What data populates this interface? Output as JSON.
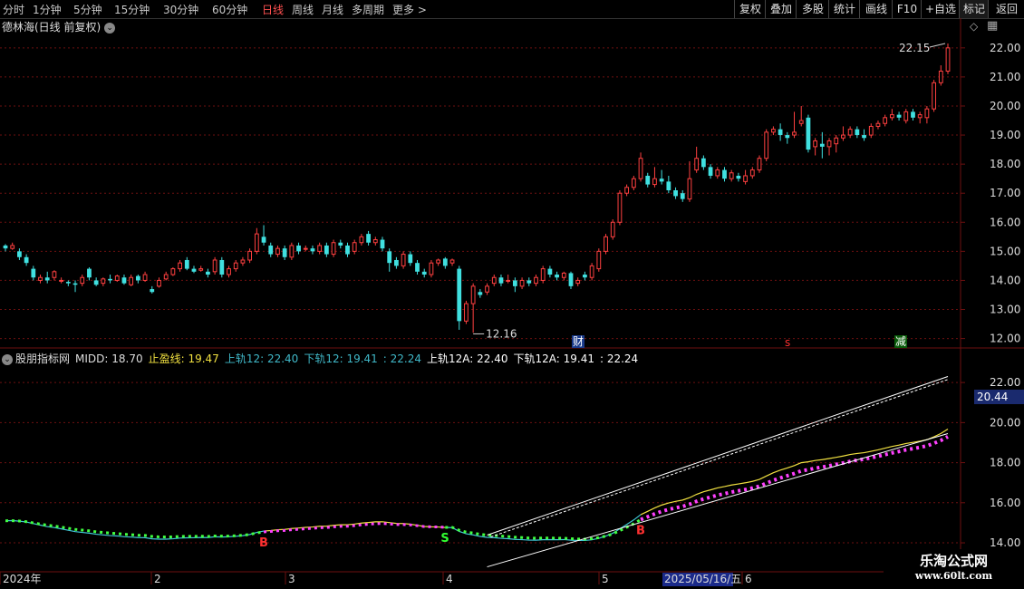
{
  "toolbar": {
    "items": [
      "分时",
      "1分钟",
      "5分钟",
      "15分钟",
      "30分钟",
      "60分钟",
      "日线",
      "周线",
      "月线",
      "多周期",
      "更多 >"
    ],
    "active_index": 6,
    "right_items": [
      "复权",
      "叠加",
      "多股",
      "统计",
      "画线",
      "F10",
      "+自选",
      "返回"
    ]
  },
  "title": {
    "text": "德林海(日线 前复权)",
    "chevron": "⌄",
    "dia_icon": "◇",
    "grid_icon": "▦"
  },
  "price_axis": {
    "labels": [
      "22.00",
      "21.00",
      "20.00",
      "19.00",
      "18.00",
      "17.00",
      "16.00",
      "15.00",
      "14.00",
      "13.00",
      "12.00"
    ]
  },
  "annotations": {
    "high": "22.15",
    "low": "12.16",
    "cai": "财",
    "s_mark": "s",
    "jian": "减"
  },
  "indicator": {
    "chevron": "⌄",
    "name": "股朋指标网",
    "midd": "MIDD: 18.70",
    "stop": "止盈线: 19.47",
    "upper12": "上轨12: 22.40",
    "lower12": "下轨12: 19.41",
    "val1": ": 22.24",
    "upper12a": "上轨12A: 22.40",
    "lower12a": "下轨12A: 19.41",
    "val2": ": 22.24",
    "axis": [
      "22.00",
      "20.00",
      "18.00",
      "16.00",
      "14.00"
    ],
    "last_value": "20.44",
    "marks": {
      "b1": "B",
      "s1": "S",
      "b2": "B"
    }
  },
  "date_axis": {
    "labels": [
      "2024年",
      "2",
      "3",
      "4",
      "5",
      "6"
    ],
    "highlight": "2025/05/16/五"
  },
  "watermark": {
    "line1": "乐淘公式网",
    "line2": "www.60lt.com"
  },
  "colors": {
    "up": "#ff4040",
    "down": "#40e0e0",
    "bg": "#000000",
    "grid": "#6e1010",
    "yellow": "#f0e040",
    "magenta": "#ff40ff",
    "green": "#40ff40",
    "cyan": "#40c8d8"
  },
  "chart_data": {
    "type": "candlestick",
    "price_range": [
      11.8,
      22.4
    ],
    "candles": [
      [
        15.2,
        15.1,
        15.25,
        15.0
      ],
      [
        15.1,
        15.2,
        15.3,
        15.05
      ],
      [
        15.0,
        14.8,
        15.1,
        14.7
      ],
      [
        14.8,
        14.6,
        14.9,
        14.5
      ],
      [
        14.4,
        14.1,
        14.5,
        14.0
      ],
      [
        14.0,
        14.1,
        14.2,
        13.9
      ],
      [
        14.1,
        14.0,
        14.3,
        13.9
      ],
      [
        14.1,
        14.3,
        14.35,
        14.0
      ],
      [
        14.0,
        14.0,
        14.1,
        13.9
      ],
      [
        13.95,
        13.9,
        14.0,
        13.8
      ],
      [
        13.9,
        13.85,
        14.0,
        13.6
      ],
      [
        13.9,
        14.1,
        14.2,
        13.8
      ],
      [
        14.4,
        14.1,
        14.45,
        14.0
      ],
      [
        14.0,
        13.85,
        14.1,
        13.8
      ],
      [
        13.9,
        14.05,
        14.1,
        13.8
      ],
      [
        14.05,
        14.0,
        14.2,
        13.9
      ],
      [
        14.0,
        14.15,
        14.2,
        13.95
      ],
      [
        14.1,
        13.9,
        14.2,
        13.85
      ],
      [
        13.85,
        14.1,
        14.2,
        13.8
      ],
      [
        14.15,
        14.0,
        14.2,
        13.9
      ],
      [
        14.0,
        14.2,
        14.3,
        13.95
      ],
      [
        13.7,
        13.6,
        13.8,
        13.55
      ],
      [
        13.8,
        14.0,
        14.1,
        13.75
      ],
      [
        14.05,
        14.2,
        14.3,
        14.0
      ],
      [
        14.2,
        14.4,
        14.45,
        14.15
      ],
      [
        14.4,
        14.6,
        14.7,
        14.3
      ],
      [
        14.7,
        14.4,
        14.8,
        14.35
      ],
      [
        14.4,
        14.3,
        14.5,
        14.25
      ],
      [
        14.35,
        14.4,
        14.5,
        14.3
      ],
      [
        14.3,
        14.2,
        14.4,
        14.1
      ],
      [
        14.3,
        14.7,
        14.8,
        14.2
      ],
      [
        14.7,
        14.2,
        14.8,
        14.1
      ],
      [
        14.2,
        14.4,
        14.5,
        14.1
      ],
      [
        14.4,
        14.6,
        14.7,
        14.3
      ],
      [
        14.6,
        14.7,
        14.8,
        14.5
      ],
      [
        14.7,
        15.0,
        15.1,
        14.6
      ],
      [
        15.0,
        15.6,
        15.8,
        14.9
      ],
      [
        15.5,
        15.3,
        15.9,
        15.2
      ],
      [
        15.2,
        14.9,
        15.3,
        14.8
      ],
      [
        14.9,
        15.1,
        15.2,
        14.8
      ],
      [
        15.1,
        14.8,
        15.2,
        14.7
      ],
      [
        14.8,
        15.2,
        15.3,
        14.7
      ],
      [
        15.2,
        15.0,
        15.3,
        14.9
      ],
      [
        15.1,
        15.1,
        15.2,
        15.0
      ],
      [
        15.1,
        15.0,
        15.2,
        14.9
      ],
      [
        15.0,
        15.2,
        15.3,
        14.9
      ],
      [
        15.2,
        14.9,
        15.3,
        14.8
      ],
      [
        14.9,
        15.3,
        15.4,
        14.8
      ],
      [
        15.3,
        15.2,
        15.4,
        15.1
      ],
      [
        15.2,
        14.9,
        15.3,
        14.8
      ],
      [
        15.0,
        15.3,
        15.4,
        14.9
      ],
      [
        15.3,
        15.5,
        15.6,
        15.2
      ],
      [
        15.6,
        15.3,
        15.7,
        15.2
      ],
      [
        15.3,
        15.4,
        15.5,
        15.2
      ],
      [
        15.4,
        15.1,
        15.5,
        15.0
      ],
      [
        15.0,
        14.6,
        15.1,
        14.3
      ],
      [
        14.7,
        14.5,
        14.8,
        14.4
      ],
      [
        14.5,
        14.9,
        15.0,
        14.4
      ],
      [
        14.9,
        14.6,
        15.0,
        14.5
      ],
      [
        14.6,
        14.3,
        14.7,
        14.2
      ],
      [
        14.3,
        14.2,
        14.4,
        14.1
      ],
      [
        14.2,
        14.6,
        14.7,
        14.1
      ],
      [
        14.6,
        14.7,
        14.75,
        14.5
      ],
      [
        14.75,
        14.5,
        14.8,
        14.4
      ],
      [
        14.6,
        14.7,
        14.75,
        14.5
      ],
      [
        14.4,
        12.6,
        14.5,
        12.3
      ],
      [
        12.6,
        13.2,
        13.3,
        12.5
      ],
      [
        13.2,
        13.8,
        13.9,
        12.2
      ],
      [
        13.6,
        13.5,
        13.7,
        13.4
      ],
      [
        13.6,
        13.8,
        13.9,
        13.5
      ],
      [
        13.9,
        14.1,
        14.2,
        13.8
      ],
      [
        14.1,
        13.9,
        14.2,
        13.8
      ],
      [
        14.0,
        14.0,
        14.2,
        13.9
      ],
      [
        14.0,
        13.8,
        14.1,
        13.6
      ],
      [
        13.8,
        14.0,
        14.1,
        13.7
      ],
      [
        14.0,
        13.9,
        14.1,
        13.8
      ],
      [
        13.9,
        14.1,
        14.2,
        13.8
      ],
      [
        14.0,
        14.4,
        14.5,
        13.9
      ],
      [
        14.4,
        14.2,
        14.5,
        14.1
      ],
      [
        14.2,
        14.1,
        14.3,
        14.0
      ],
      [
        14.1,
        14.25,
        14.3,
        14.0
      ],
      [
        14.25,
        13.8,
        14.3,
        13.7
      ],
      [
        13.9,
        14.0,
        14.1,
        13.8
      ],
      [
        14.2,
        14.1,
        14.3,
        14.0
      ],
      [
        14.1,
        14.5,
        14.6,
        14.0
      ],
      [
        14.4,
        15.0,
        15.1,
        14.3
      ],
      [
        15.0,
        15.5,
        15.6,
        14.9
      ],
      [
        15.5,
        16.0,
        16.1,
        15.4
      ],
      [
        16.0,
        17.0,
        17.1,
        15.9
      ],
      [
        17.0,
        17.2,
        17.3,
        16.9
      ],
      [
        17.2,
        17.5,
        17.6,
        17.1
      ],
      [
        17.5,
        18.2,
        18.4,
        17.4
      ],
      [
        17.6,
        17.3,
        17.7,
        17.2
      ],
      [
        17.3,
        17.5,
        17.9,
        17.2
      ],
      [
        17.5,
        17.4,
        17.8,
        17.3
      ],
      [
        17.4,
        17.1,
        17.6,
        17.0
      ],
      [
        17.1,
        16.9,
        17.2,
        16.8
      ],
      [
        17.0,
        16.8,
        17.1,
        16.7
      ],
      [
        16.8,
        17.5,
        18.1,
        16.7
      ],
      [
        17.8,
        18.2,
        18.6,
        17.7
      ],
      [
        18.2,
        17.9,
        18.3,
        17.8
      ],
      [
        17.9,
        17.6,
        18.0,
        17.5
      ],
      [
        17.6,
        17.8,
        17.9,
        17.5
      ],
      [
        17.8,
        17.5,
        17.9,
        17.4
      ],
      [
        17.5,
        17.7,
        17.8,
        17.4
      ],
      [
        17.6,
        17.5,
        17.7,
        17.4
      ],
      [
        17.4,
        17.6,
        17.8,
        17.3
      ],
      [
        17.6,
        17.8,
        17.9,
        17.5
      ],
      [
        17.8,
        18.2,
        18.3,
        17.7
      ],
      [
        18.2,
        19.1,
        19.2,
        18.1
      ],
      [
        19.1,
        19.2,
        19.3,
        19.0
      ],
      [
        19.2,
        19.0,
        19.4,
        18.8
      ],
      [
        19.0,
        18.9,
        19.1,
        18.7
      ],
      [
        19.0,
        19.1,
        19.8,
        18.9
      ],
      [
        19.4,
        19.5,
        20.0,
        19.3
      ],
      [
        19.6,
        18.5,
        19.7,
        18.4
      ],
      [
        18.6,
        18.8,
        18.9,
        18.3
      ],
      [
        18.7,
        18.6,
        19.1,
        18.2
      ],
      [
        18.6,
        18.8,
        18.9,
        18.3
      ],
      [
        18.7,
        18.9,
        19.0,
        18.4
      ],
      [
        18.9,
        19.0,
        19.3,
        18.8
      ],
      [
        19.0,
        19.2,
        19.3,
        18.9
      ],
      [
        19.2,
        19.0,
        19.3,
        18.9
      ],
      [
        19.0,
        18.9,
        19.2,
        18.8
      ],
      [
        19.0,
        19.3,
        19.4,
        18.9
      ],
      [
        19.3,
        19.4,
        19.5,
        19.2
      ],
      [
        19.4,
        19.6,
        19.7,
        19.3
      ],
      [
        19.6,
        19.7,
        19.9,
        19.5
      ],
      [
        19.7,
        19.6,
        19.8,
        19.5
      ],
      [
        19.5,
        19.8,
        19.9,
        19.4
      ],
      [
        19.8,
        19.6,
        19.9,
        19.5
      ],
      [
        19.6,
        19.7,
        19.8,
        19.4
      ],
      [
        19.6,
        19.9,
        20.0,
        19.4
      ],
      [
        19.9,
        20.8,
        20.9,
        19.8
      ],
      [
        20.8,
        21.2,
        21.4,
        20.7
      ],
      [
        21.2,
        22.0,
        22.15,
        21.1
      ]
    ]
  }
}
